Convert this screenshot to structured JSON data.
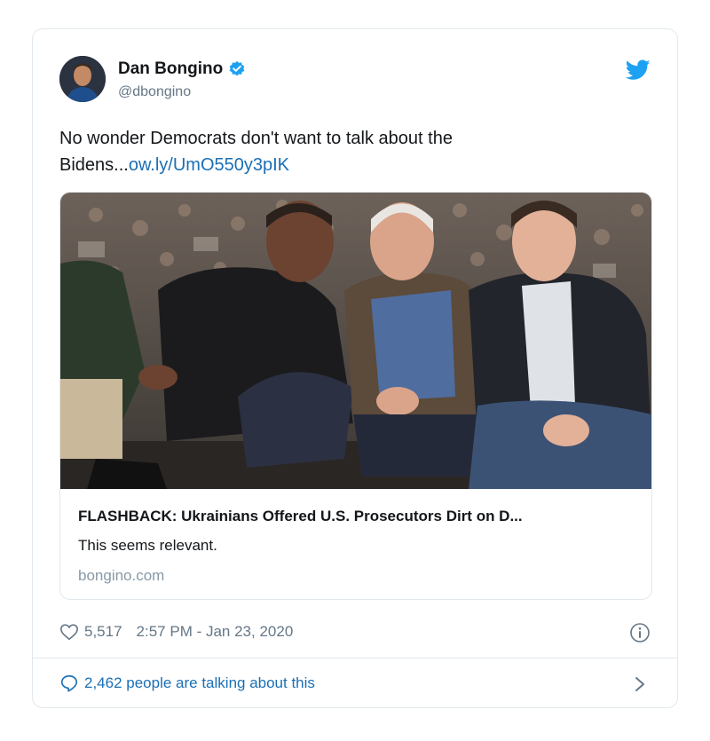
{
  "tweet": {
    "author_name": "Dan Bongino",
    "author_handle": "@dbongino",
    "text": "No wonder Democrats don't want to talk about the Bidens...",
    "link_text": "ow.ly/UmO550y3pIK"
  },
  "link_card": {
    "title": "FLASHBACK: Ukrainians Offered U.S. Prosecutors Dirt on D...",
    "description": "This seems relevant.",
    "domain": "bongino.com"
  },
  "meta": {
    "likes": "5,517",
    "timestamp": "2:57 PM - Jan 23, 2020"
  },
  "footer": {
    "conversation": "2,462 people are talking about this"
  },
  "colors": {
    "twitter_blue": "#1da1f2",
    "link_blue": "#1b6fb5",
    "muted_gray": "#657786",
    "border": "#e1e8ed"
  },
  "icons": [
    "verified-badge-icon",
    "twitter-bird-icon",
    "heart-icon",
    "info-icon",
    "speech-bubble-icon",
    "chevron-right-icon"
  ]
}
